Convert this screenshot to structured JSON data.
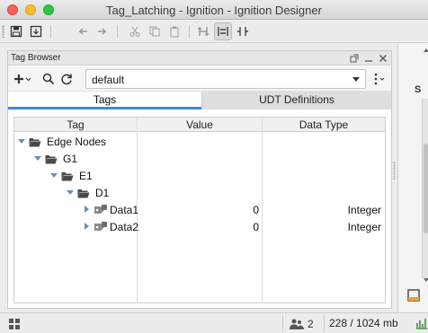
{
  "window": {
    "title": "Tag_Latching - Ignition - Ignition Designer"
  },
  "toolbar": {
    "buttons": [
      {
        "name": "save-icon"
      },
      {
        "name": "save-all-icon"
      },
      {
        "name": "undo-icon"
      },
      {
        "name": "redo-icon"
      },
      {
        "name": "cut-icon"
      },
      {
        "name": "copy-icon"
      },
      {
        "name": "paste-icon"
      },
      {
        "name": "snap-icon"
      },
      {
        "name": "align-icon"
      },
      {
        "name": "distribute-icon"
      }
    ]
  },
  "tag_browser": {
    "panel_title": "Tag Browser",
    "provider": "default",
    "tabs": [
      {
        "label": "Tags",
        "active": true
      },
      {
        "label": "UDT Definitions",
        "active": false
      }
    ],
    "columns": [
      "Tag",
      "Value",
      "Data Type"
    ],
    "rows": [
      {
        "name": "Edge Nodes",
        "kind": "folder",
        "level": 0,
        "expanded": true,
        "value": "",
        "data_type": ""
      },
      {
        "name": "G1",
        "kind": "folder",
        "level": 1,
        "expanded": true,
        "value": "",
        "data_type": ""
      },
      {
        "name": "E1",
        "kind": "folder",
        "level": 2,
        "expanded": true,
        "value": "",
        "data_type": ""
      },
      {
        "name": "D1",
        "kind": "folder",
        "level": 3,
        "expanded": true,
        "value": "",
        "data_type": ""
      },
      {
        "name": "Data1",
        "kind": "tag",
        "level": 4,
        "expanded": false,
        "value": "0",
        "data_type": "Integer"
      },
      {
        "name": "Data2",
        "kind": "tag",
        "level": 4,
        "expanded": false,
        "value": "0",
        "data_type": "Integer"
      }
    ]
  },
  "right_pane": {
    "visible_letter": "S"
  },
  "statusbar": {
    "users_count": "2",
    "memory": "228 / 1024 mb"
  },
  "colors": {
    "accent": "#3d8cd9",
    "folder": "#4a4a4a",
    "tree_caret": "#6a8fb5"
  }
}
